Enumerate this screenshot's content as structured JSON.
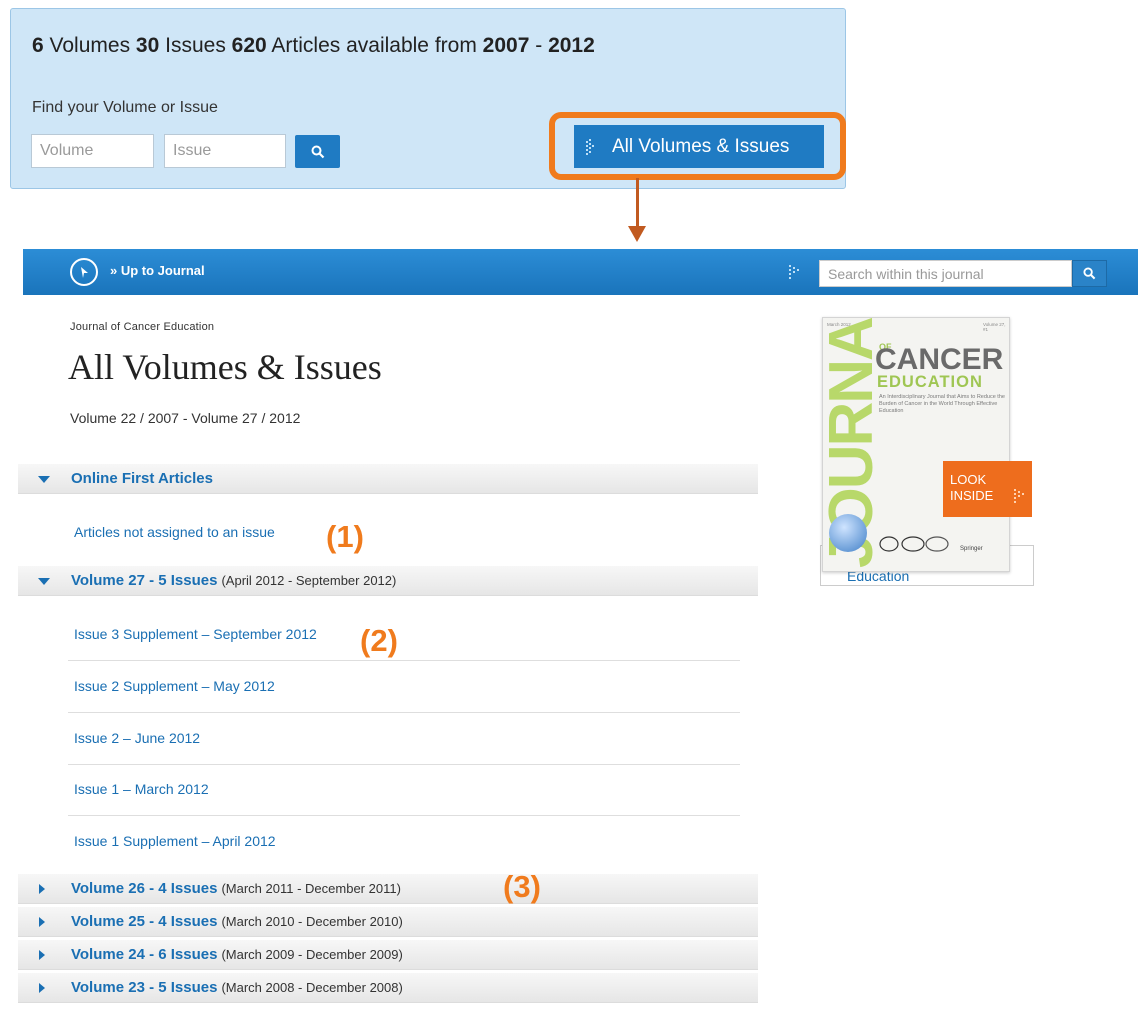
{
  "summary": {
    "volumes_count": "6",
    "volumes_label": "Volumes",
    "issues_count": "30",
    "issues_label": "Issues",
    "articles_count": "620",
    "articles_label": "Articles available from",
    "year_from": "2007",
    "dash": "-",
    "year_to": "2012"
  },
  "finder": {
    "label": "Find your Volume or Issue",
    "volume_placeholder": "Volume",
    "issue_placeholder": "Issue",
    "search_icon": "search-icon"
  },
  "all_volumes_button": {
    "label": "All Volumes & Issues",
    "icon": "arrow-right-icon",
    "highlight_color": "#f07b1d"
  },
  "navbar": {
    "compass_icon": "compass-icon",
    "up_link": "» Up to Journal",
    "search_placeholder": "Search within this journal",
    "background": "#1f7bc3"
  },
  "header": {
    "journal_name": "Journal of Cancer Education",
    "title": "All Volumes & Issues",
    "volume_range": "Volume 22 / 2007 - Volume 27 / 2012"
  },
  "sections": [
    {
      "title": "Online First Articles",
      "dates": "",
      "expanded": true,
      "items": [
        "Articles not assigned to an issue"
      ]
    },
    {
      "title": "Volume 27 - 5 Issues",
      "dates": "(April 2012 - September 2012)",
      "expanded": true,
      "items": [
        "Issue 3 Supplement – September 2012",
        "Issue 2 Supplement – May 2012",
        "Issue 2 – June 2012",
        "Issue 1 – March 2012",
        "Issue 1 Supplement – April 2012"
      ]
    },
    {
      "title": "Volume 26 - 4 Issues",
      "dates": "(March 2011 - December 2011)",
      "expanded": false,
      "items": []
    },
    {
      "title": "Volume 25 - 4 Issues",
      "dates": "(March 2010 - December 2010)",
      "expanded": false,
      "items": []
    },
    {
      "title": "Volume 24 - 6 Issues",
      "dates": "(March 2009 - December 2009)",
      "expanded": false,
      "items": []
    },
    {
      "title": "Volume 23 - 5 Issues",
      "dates": "(March 2008 - December 2008)",
      "expanded": false,
      "items": []
    }
  ],
  "annotations": [
    "(1)",
    "(2)",
    "(3)"
  ],
  "cover": {
    "journal_word": "JOURNAL",
    "of": "OF",
    "cancer": "CANCER",
    "education": "EDUCATION",
    "tagline": "An Interdisciplinary Journal that Aims to Reduce the Burden of Cancer in the World Through Effective Education",
    "date": "March 2012",
    "issue": "Volume 27, #1",
    "publisher": "Springer",
    "look_inside_line1": "LOOK",
    "look_inside_line2": "INSIDE",
    "caption": "Education"
  }
}
